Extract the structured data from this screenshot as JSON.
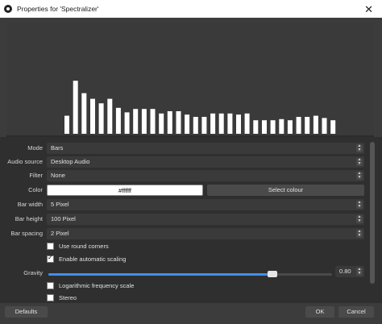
{
  "window": {
    "title": "Properties for 'Spectralizer'",
    "close_glyph": "✕"
  },
  "preview": {
    "bar_color": "#ffffff",
    "bars": [
      0.16,
      0.47,
      0.36,
      0.31,
      0.27,
      0.31,
      0.23,
      0.19,
      0.22,
      0.22,
      0.22,
      0.18,
      0.2,
      0.2,
      0.17,
      0.15,
      0.15,
      0.18,
      0.18,
      0.18,
      0.17,
      0.18,
      0.12,
      0.12,
      0.12,
      0.13,
      0.12,
      0.15,
      0.15,
      0.16,
      0.14,
      0.12
    ]
  },
  "form": {
    "mode": {
      "label": "Mode",
      "value": "Bars"
    },
    "audio_source": {
      "label": "Audio source",
      "value": "Desktop Audio"
    },
    "filter": {
      "label": "Filter",
      "value": "None"
    },
    "color": {
      "label": "Color",
      "value": "#ffffff",
      "button": "Select colour"
    },
    "bar_width": {
      "label": "Bar width",
      "value": "5 Pixel"
    },
    "bar_height": {
      "label": "Bar height",
      "value": "100 Pixel"
    },
    "bar_spacing": {
      "label": "Bar spacing",
      "value": "2 Pixel"
    },
    "round_corners": {
      "label": "Use round corners",
      "checked": false
    },
    "auto_scaling": {
      "label": "Enable automatic scaling",
      "checked": true
    },
    "gravity": {
      "label": "Gravity",
      "value": "0.80",
      "fraction": 0.8
    },
    "log_scale": {
      "label": "Logarithmic frequency scale",
      "checked": false
    },
    "stereo": {
      "label": "Stereo",
      "checked": false
    }
  },
  "buttons": {
    "defaults": "Defaults",
    "ok": "OK",
    "cancel": "Cancel"
  },
  "accent": "#3f8ff2"
}
